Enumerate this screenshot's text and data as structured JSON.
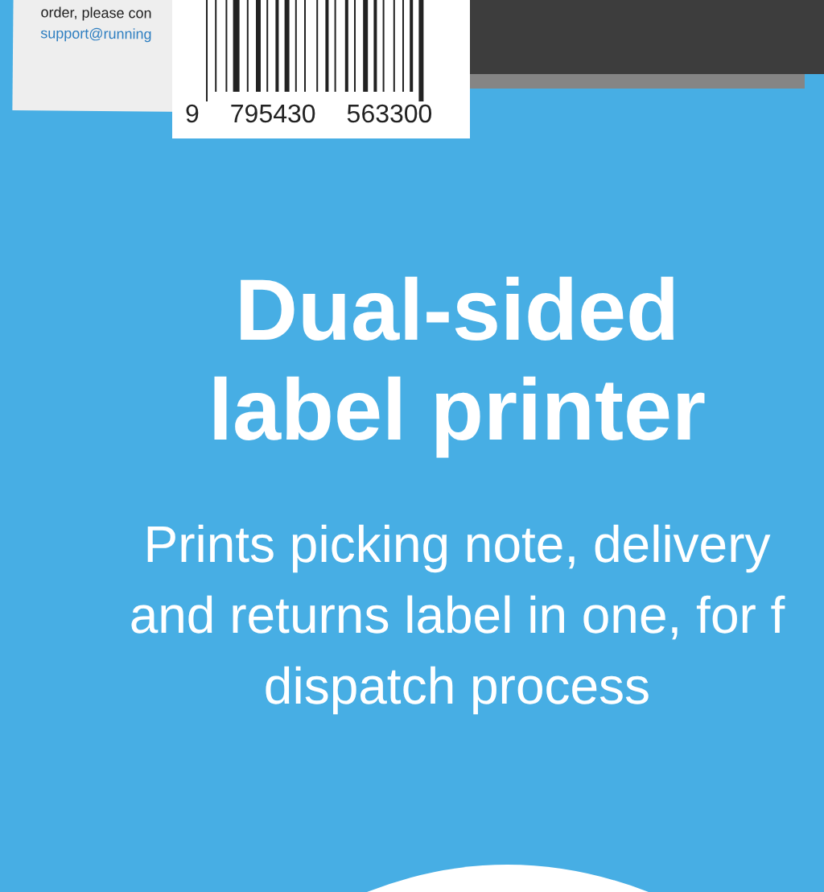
{
  "packing_slip": {
    "lines": [
      "order, please con"
    ],
    "email": "support@running"
  },
  "barcode": {
    "digits": [
      "9",
      "795430",
      "563300"
    ]
  },
  "headline": [
    "Dual-sided",
    "label printer"
  ],
  "subtitle": [
    "Prints picking note, delivery",
    "and returns label in one, for f",
    "dispatch process"
  ]
}
